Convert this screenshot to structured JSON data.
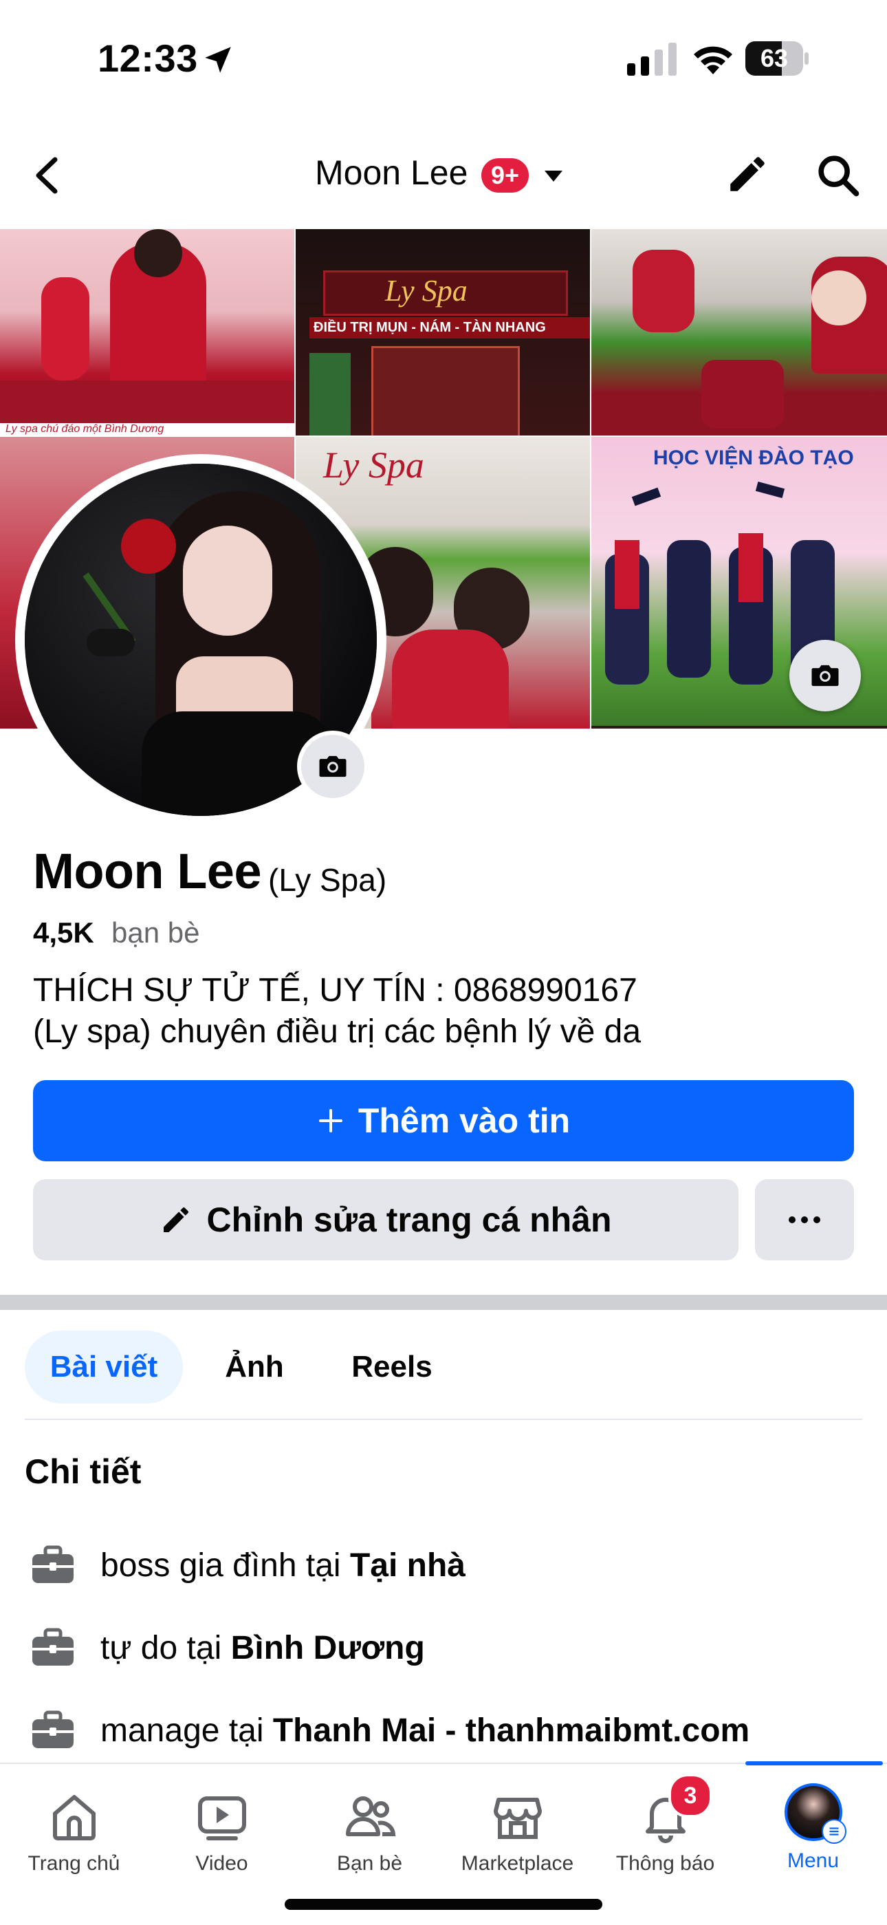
{
  "status_bar": {
    "time": "12:33",
    "battery": "63",
    "battery_level": 0.63
  },
  "header": {
    "title": "Moon Lee",
    "badge": "9+"
  },
  "profile": {
    "name": "Moon Lee",
    "alternate_name": "(Ly Spa)",
    "friends_count": "4,5K",
    "friends_label": "bạn bè",
    "bio": [
      "THÍCH SỰ TỬ TẾ, UY TÍN : 0868990167",
      "(Ly spa) chuyên điều trị các bệnh lý về da"
    ]
  },
  "cover": {
    "sign_text": "Ly Spa",
    "sign_sub": "ĐIỀU TRỊ MỤN - NÁM - TÀN NHANG",
    "caption": "Ly spa chú đáo một Bình Dương",
    "banner_text": "HỌC VIỆN ĐÀO TẠO"
  },
  "actions": {
    "add_story": "Thêm vào tin",
    "edit_profile": "Chỉnh sửa trang cá nhân"
  },
  "tabs": [
    "Bài viết",
    "Ảnh",
    "Reels"
  ],
  "details": {
    "title": "Chi tiết",
    "items": [
      {
        "role": "boss gia đình",
        "prep": "tại",
        "place": "Tại nhà"
      },
      {
        "role": "tự do",
        "prep": "tại",
        "place": "Bình Dương"
      },
      {
        "role": "manage",
        "prep": "tại",
        "place": "Thanh Mai - thanhmaibmt.com"
      }
    ]
  },
  "bottom_nav": {
    "items": [
      {
        "label": "Trang chủ",
        "icon": "home-icon"
      },
      {
        "label": "Video",
        "icon": "video-icon"
      },
      {
        "label": "Bạn bè",
        "icon": "friends-icon"
      },
      {
        "label": "Marketplace",
        "icon": "marketplace-icon"
      },
      {
        "label": "Thông báo",
        "icon": "bell-icon"
      },
      {
        "label": "Menu",
        "icon": "menu-avatar-icon"
      }
    ],
    "notification_count": "3",
    "active": "Menu"
  },
  "colors": {
    "primary": "#0866ff",
    "badge": "#e41e3f",
    "secondary_bg": "#e4e6eb"
  }
}
